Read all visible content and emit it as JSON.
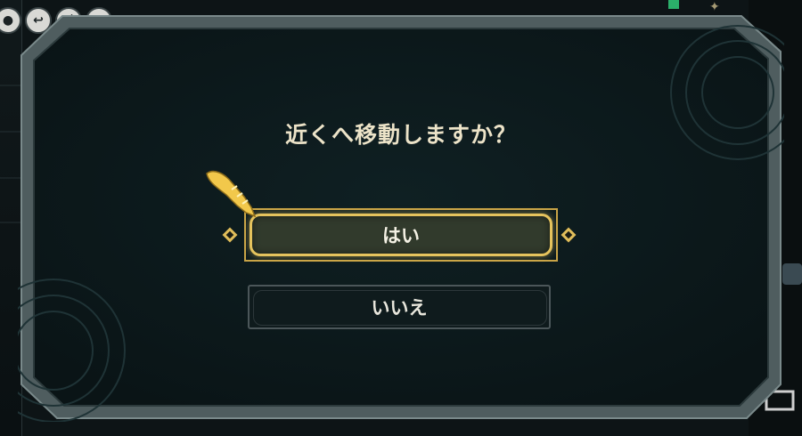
{
  "dialog": {
    "title": "近くへ移動しますか？",
    "yes_label": "はい",
    "no_label": "いいえ"
  },
  "hud": {
    "icons": [
      "circle-icon",
      "return-icon",
      "swap-icon",
      "map-icon"
    ]
  },
  "colors": {
    "accent_gold": "#e5c35d",
    "panel_bg": "#0c1a1c",
    "frame_gray": "#59686a",
    "title_text": "#ece3c8"
  }
}
